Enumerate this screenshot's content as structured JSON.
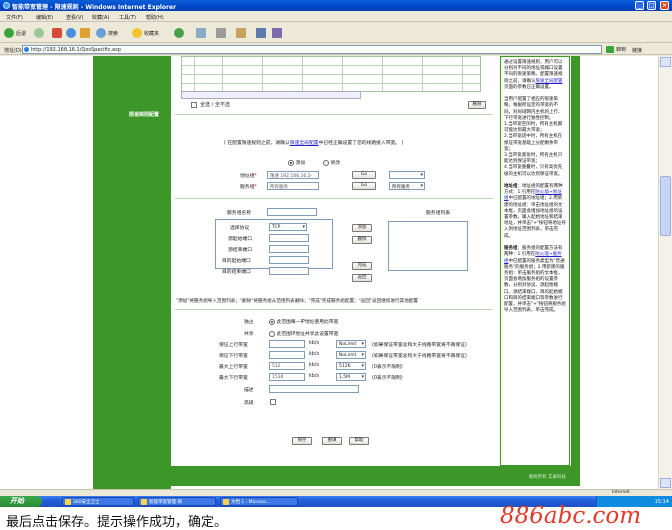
{
  "window": {
    "title": "智能带宽管理 - 限速规则 - Windows Internet Explorer",
    "buttons": [
      "_",
      "□",
      "×"
    ]
  },
  "menu": [
    "文件(F)",
    "编辑(E)",
    "查看(V)",
    "收藏(A)",
    "工具(T)",
    "帮助(H)"
  ],
  "toolbar": {
    "back": "后退",
    "search": "搜索",
    "favorites": "收藏夹"
  },
  "address": {
    "label": "地址(D)",
    "url": "http://192.168.16.1/QosSpecific.asp",
    "go": "转到",
    "links": "链接"
  },
  "left": {
    "section": "限速规则配置"
  },
  "list": {
    "select_all": "全选 / 全不选",
    "delete": "删除"
  },
  "desc": {
    "before": "( 在配置限速规则之前，请确认",
    "link": "限速全局配置",
    "after": "中已经正确设置了您的线路接入带宽。 )"
  },
  "mode": {
    "add": "添加",
    "modify": "修改"
  },
  "address_group": {
    "label": "地址组",
    "value": "限速 192.168.16.2-",
    "go_btn": "Go",
    "select": ""
  },
  "service_group": {
    "label": "服务组",
    "value": "所有服务",
    "go_btn": "Go",
    "select": "所有服务"
  },
  "service_name_label": "服务组名称",
  "service_list_label": "服务组列表",
  "service": {
    "protocol_label": "选择协议",
    "protocol": "TCP",
    "src_start": "源起始端口",
    "src_end": "源结束端口",
    "dst_start": "目的起始端口",
    "dst_end": "目的结束端口",
    "add_btn": "添加",
    "del_btn": "删除",
    "done_btn": "完成",
    "back_btn": "返回"
  },
  "hint": "\"添加\"将服务组导入范围列表；\"删除\"将服务组从范围列表删除；\"完成\"完成服务组配置；\"返回\"返回继续进行其他配置",
  "exclusive": {
    "label": "独占",
    "text": "此范围每一IP地址使用此带宽"
  },
  "shared": {
    "label": "共享",
    "text": "此范围IP地址共享此设置带宽"
  },
  "bw_rows": [
    {
      "label": "保证上行带宽",
      "value": "",
      "unit": "kb/s",
      "sel": "NoLimit",
      "note": "(如果保证带宽总和大于线路带宽将不再保证)"
    },
    {
      "label": "保证下行带宽",
      "value": "",
      "unit": "kb/s",
      "sel": "NoLimit",
      "note": "(如果保证带宽总和大于线路带宽将不再保证)"
    },
    {
      "label": "最大上行带宽",
      "value": "512",
      "unit": "kb/s",
      "sel": "512K",
      "note": "(0表示不限制)"
    },
    {
      "label": "最大下行带宽",
      "value": "1536",
      "unit": "kb/s",
      "sel": "1.5M",
      "note": "(0表示不限制)"
    }
  ],
  "desc_label": "描述",
  "advanced_label": "高级",
  "actions": {
    "save": "保存",
    "reset": "重填",
    "help": "帮助"
  },
  "right_panel": {
    "p1": "通过设置限速规则，用户可以分别对不同的地址或端口设置不同的限速策略。配置限速规则之前，请确认",
    "p1_link": "限速全局配置",
    "p1_end": "页面的参数已正确设置。",
    "p2": "当用户配置了相应的限速策略，根据所设定的带宽的不同，对局域网内主机的上行、下行带宽进行独性控制。",
    "p3": "1.当带宽空闲时，所有主机都可能达到最大带宽；",
    "p4": "2.当带宽适中时，所有主机在保证带宽基础上分配剩余带宽；",
    "p5": "3.当带宽紧张时，所有主机只能达到保证带宽；",
    "p6": "4.当带宽重叠时，只有高优先级的主机可以达到保证带宽。",
    "h_addr": "地址组",
    "addr_text": "：地址组的配置有两种方式：1.引用在",
    "addr_link": "防火墙→地址组",
    "addr_text2": "中已配置的地址组；2.用新建的地址组：单击地址组的文本框，页面会增加地址组的设置参数，输入起始地址和结束地址，并单击\"+\"按钮将地址导入到地址范围列表，单击完成。",
    "h_svc": "服务组",
    "svc_text": "：服务组的配置方法有两种：1.引用在",
    "svc_link": "防火墙→服务组",
    "svc_text2": "中已配置的服务类型为\"普通服务\"的服务组；2.用新建的服务组：单击服务组的文本框，页面会增加服务组的设置参数，分别对协议、源起始端口、源结束端口、目的起始端口和目的结束端口等参数进行配置，并单击\"+\"按钮将服务组导入范围列表，单击完成。"
  },
  "footer": {
    "copyright": "版权所有 艾泰科技"
  },
  "status": {
    "zone": "Internet"
  },
  "taskbar": {
    "start": "开始",
    "tasks": [
      "360安全卫士",
      "智能带宽管理-限",
      "文档 1 - Microso..."
    ],
    "clock": "15:14"
  },
  "caption": "最后点击保存。提示操作成功，确定。",
  "watermark": "886abc.com"
}
